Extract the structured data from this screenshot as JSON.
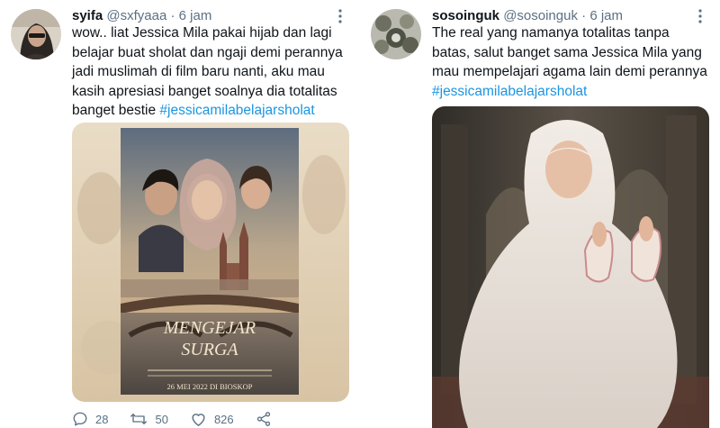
{
  "tweets": [
    {
      "display_name": "syifa",
      "handle": "@sxfyaaa",
      "separator": "·",
      "time": "6 jam",
      "text": "wow.. liat Jessica Mila pakai hijab dan lagi belajar buat sholat dan ngaji demi perannya jadi muslimah di film baru nanti, aku mau kasih apresiasi banget soalnya dia totalitas banget bestie ",
      "hashtag": "#jessicamilabelajarsholat",
      "poster": {
        "title_line1": "MENGEJAR",
        "title_line2": "SURGA",
        "date_line": "26 MEI 2022 DI BIOSKOP"
      },
      "actions": {
        "replies": "28",
        "retweets": "50",
        "likes": "826"
      }
    },
    {
      "display_name": "sosoinguk",
      "handle": "@sosoinguk",
      "separator": "·",
      "time": "6 jam",
      "text": "The real yang namanya totalitas tanpa batas, salut banget sama Jessica Mila yang mau mempelajari agama lain demi perannya ",
      "hashtag": "#jessicamilabelajarsholat"
    }
  ],
  "colors": {
    "text": "#0f1419",
    "secondary": "#5b7083",
    "hashtag": "#1b95e0"
  },
  "icons": [
    "more-icon",
    "reply-icon",
    "retweet-icon",
    "like-icon",
    "share-icon"
  ]
}
